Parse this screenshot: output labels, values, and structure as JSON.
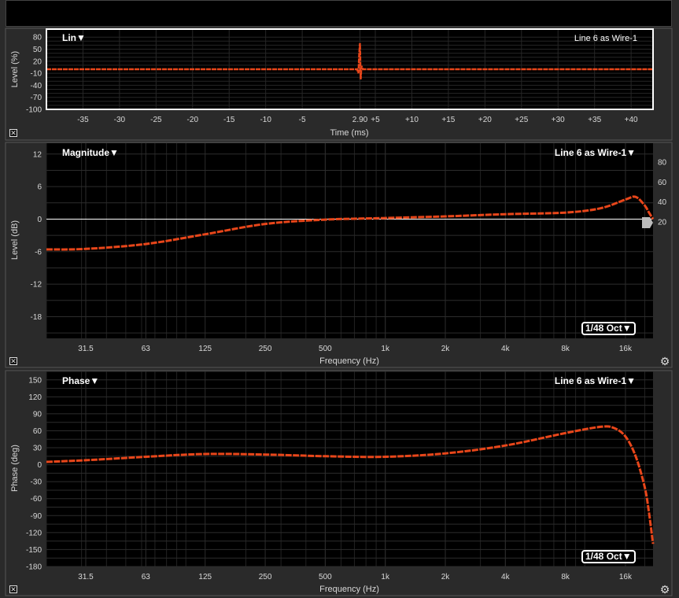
{
  "topbar": {},
  "impulse": {
    "title": "Lin▼",
    "legend": "Line 6 as Wire-1",
    "xlabel": "Time (ms)",
    "ylabel": "Level (%)",
    "y_ticks": [
      "80",
      "50",
      "20",
      "-10",
      "-40",
      "-70",
      "-100"
    ],
    "x_ticks": [
      "-35",
      "-30",
      "-25",
      "-20",
      "-15",
      "-10",
      "-5",
      "2.90",
      "+5",
      "+10",
      "+15",
      "+20",
      "+25",
      "+30",
      "+35",
      "+40"
    ]
  },
  "magnitude": {
    "title": "Magnitude▼",
    "legend": "Line 6 as Wire-1▼",
    "xlabel": "Frequency (Hz)",
    "ylabel": "Level (dB)",
    "y_ticks": [
      "12",
      "6",
      "0",
      "-6",
      "-12",
      "-18"
    ],
    "right_ticks": [
      "80",
      "60",
      "40",
      "20"
    ],
    "x_ticks": [
      "31.5",
      "63",
      "125",
      "250",
      "500",
      "1k",
      "2k",
      "4k",
      "8k",
      "16k"
    ],
    "smoothing": "1/48 Oct▼"
  },
  "phase": {
    "title": "Phase▼",
    "legend": "Line 6 as Wire-1▼",
    "xlabel": "Frequency (Hz)",
    "ylabel": "Phase (deg)",
    "y_ticks": [
      "150",
      "120",
      "90",
      "60",
      "30",
      "0",
      "-30",
      "-60",
      "-90",
      "-120",
      "-150",
      "-180"
    ],
    "x_ticks": [
      "31.5",
      "63",
      "125",
      "250",
      "500",
      "1k",
      "2k",
      "4k",
      "8k",
      "16k"
    ],
    "smoothing": "1/48 Oct▼"
  },
  "colors": {
    "trace": "#e8461a",
    "background": "#000000",
    "panel": "#2a2a2a",
    "grid": "#2c2c2c"
  },
  "icons": {
    "close": "close-icon",
    "settings": "gear-icon"
  },
  "chart_data": [
    {
      "type": "line",
      "title": "Lin",
      "xlabel": "Time (ms)",
      "ylabel": "Level (%)",
      "xlim": [
        -40,
        43
      ],
      "ylim": [
        -100,
        100
      ],
      "series": [
        {
          "name": "Line 6 as Wire-1",
          "x": [
            -40,
            -10,
            2.5,
            2.7,
            2.8,
            2.9,
            3.0,
            3.1,
            3.3,
            20,
            43
          ],
          "y": [
            0,
            0,
            0,
            -10,
            40,
            65,
            -25,
            8,
            0,
            0,
            0
          ]
        }
      ]
    },
    {
      "type": "line",
      "title": "Magnitude",
      "xlabel": "Frequency (Hz)",
      "ylabel": "Level (dB)",
      "xscale": "log",
      "xlim": [
        20,
        22000
      ],
      "ylim": [
        -22,
        14
      ],
      "series": [
        {
          "name": "Line 6 as Wire-1",
          "x": [
            20,
            31.5,
            63,
            125,
            250,
            500,
            1000,
            2000,
            4000,
            8000,
            12000,
            16000,
            18000,
            20000,
            21000,
            22000
          ],
          "y": [
            -5.6,
            -5.5,
            -4.6,
            -2.8,
            -0.9,
            -0.1,
            0.2,
            0.5,
            0.9,
            1.2,
            2.0,
            3.6,
            4.1,
            2.5,
            1.2,
            0.0
          ]
        }
      ]
    },
    {
      "type": "line",
      "title": "Phase",
      "xlabel": "Frequency (Hz)",
      "ylabel": "Phase (deg)",
      "xscale": "log",
      "xlim": [
        20,
        22000
      ],
      "ylim": [
        -180,
        165
      ],
      "series": [
        {
          "name": "Line 6 as Wire-1",
          "x": [
            20,
            31.5,
            63,
            125,
            250,
            500,
            1000,
            2000,
            4000,
            8000,
            12000,
            14000,
            16000,
            18000,
            20000,
            21000,
            22000
          ],
          "y": [
            5,
            8,
            14,
            19,
            18,
            15,
            14,
            20,
            34,
            56,
            67,
            65,
            50,
            15,
            -40,
            -85,
            -140
          ]
        }
      ]
    }
  ]
}
